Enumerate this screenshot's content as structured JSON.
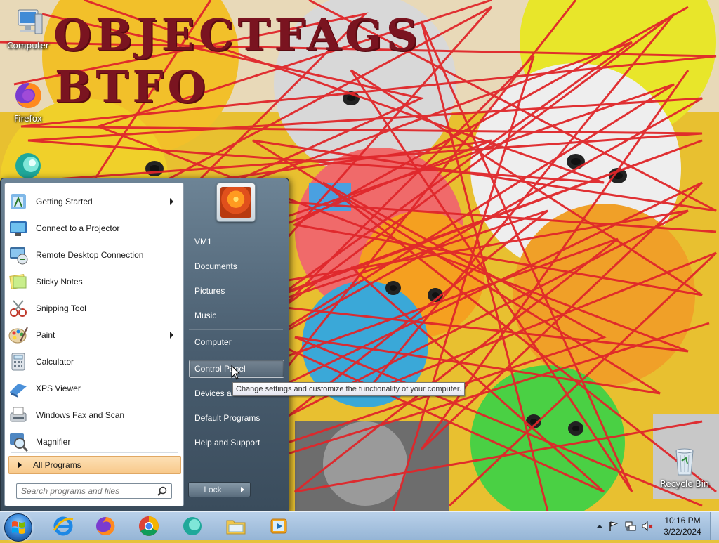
{
  "wallpaper": {
    "title_line1": "OBJECTFAGS",
    "title_line2": "BTFO"
  },
  "desktop_icons": [
    {
      "label": "Computer",
      "icon": "computer-icon"
    },
    {
      "label": "Firefox",
      "icon": "firefox-icon"
    },
    {
      "label": "",
      "icon": "app-icon"
    },
    {
      "label": "Recycle Bin",
      "icon": "recycle-bin-icon"
    }
  ],
  "start_menu": {
    "programs": [
      {
        "label": "Getting Started",
        "icon": "getting-started-icon",
        "has_submenu": true
      },
      {
        "label": "Connect to a Projector",
        "icon": "projector-icon",
        "has_submenu": false
      },
      {
        "label": "Remote Desktop Connection",
        "icon": "remote-desktop-icon",
        "has_submenu": false
      },
      {
        "label": "Sticky Notes",
        "icon": "sticky-notes-icon",
        "has_submenu": false
      },
      {
        "label": "Snipping Tool",
        "icon": "scissors-icon",
        "has_submenu": false
      },
      {
        "label": "Paint",
        "icon": "paint-palette-icon",
        "has_submenu": true
      },
      {
        "label": "Calculator",
        "icon": "calculator-icon",
        "has_submenu": false
      },
      {
        "label": "XPS Viewer",
        "icon": "xps-viewer-icon",
        "has_submenu": false
      },
      {
        "label": "Windows Fax and Scan",
        "icon": "fax-icon",
        "has_submenu": false
      },
      {
        "label": "Magnifier",
        "icon": "magnifier-icon",
        "has_submenu": false
      }
    ],
    "all_programs_label": "All Programs",
    "search_placeholder": "Search programs and files",
    "right_links": [
      {
        "label": "VM1"
      },
      {
        "label": "Documents"
      },
      {
        "label": "Pictures"
      },
      {
        "label": "Music"
      },
      {
        "label": "Computer"
      },
      {
        "label": "Control Panel",
        "hovered": true
      },
      {
        "label": "Devices and Printers"
      },
      {
        "label": "Default Programs"
      },
      {
        "label": "Help and Support"
      }
    ],
    "lock_label": "Lock",
    "tooltip": "Change settings and customize the functionality of your computer."
  },
  "taskbar": {
    "pinned": [
      {
        "name": "internet-explorer-icon"
      },
      {
        "name": "firefox-icon"
      },
      {
        "name": "chrome-icon"
      },
      {
        "name": "app-icon"
      },
      {
        "name": "file-explorer-icon"
      },
      {
        "name": "media-player-icon"
      }
    ],
    "clock_time": "10:16 PM",
    "clock_date": "3/22/2024"
  },
  "colors": {
    "wallpaper_scribble": "#e0262a",
    "title": "#7a1420",
    "taskbar": "#a9c4e0",
    "highlight": "#f8c98a"
  }
}
